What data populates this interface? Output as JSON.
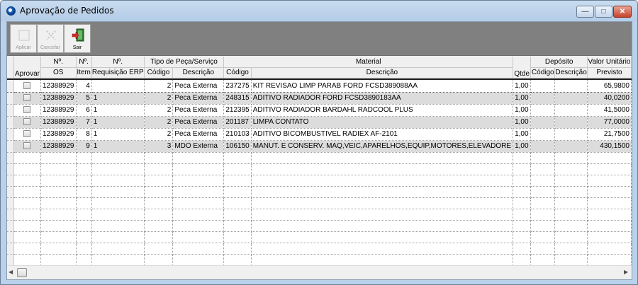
{
  "window": {
    "title": "Aprovação de Pedidos"
  },
  "toolbar": {
    "apply_label": "Aplicar",
    "cancel_label": "Cancelar",
    "exit_label": "Sair"
  },
  "grid": {
    "groups": {
      "tipo": "Tipo de Peça/Serviço",
      "material": "Material",
      "deposito": "Depósito"
    },
    "headers": {
      "aprovar": "Aprovar",
      "os_top": "Nº.",
      "os_bottom": "OS",
      "item_top": "Nº.",
      "item_bottom": "Item",
      "req_top": "Nº.",
      "req_bottom": "Requisição ERP",
      "tipo_codigo": "Código",
      "tipo_descricao": "Descrição",
      "mat_codigo": "Código",
      "mat_descricao": "Descrição",
      "qtde": "Qtde",
      "dep_codigo": "Código",
      "dep_descricao": "Descrição",
      "valor_top": "Valor Unitário",
      "valor_bottom": "Previsto"
    },
    "rows": [
      {
        "os": "12388929",
        "item": "4",
        "req": "",
        "tipo_cod": "2",
        "tipo_desc": "Peca Externa",
        "mat_cod": "237275",
        "mat_desc": "KIT REVISAO LIMP PARAB FORD FCSD389088AA",
        "qtde": "1,00",
        "dep_cod": "",
        "dep_desc": "",
        "valor": "65,9800"
      },
      {
        "os": "12388929",
        "item": "5",
        "req": "1",
        "tipo_cod": "2",
        "tipo_desc": "Peca Externa",
        "mat_cod": "248315",
        "mat_desc": "ADITIVO RADIADOR FORD FCSD3890183AA",
        "qtde": "1,00",
        "dep_cod": "",
        "dep_desc": "",
        "valor": "40,0200"
      },
      {
        "os": "12388929",
        "item": "6",
        "req": "1",
        "tipo_cod": "2",
        "tipo_desc": "Peca Externa",
        "mat_cod": "212395",
        "mat_desc": "ADITIVO RADIADOR BARDAHL RADCOOL PLUS",
        "qtde": "1,00",
        "dep_cod": "",
        "dep_desc": "",
        "valor": "41,5000"
      },
      {
        "os": "12388929",
        "item": "7",
        "req": "1",
        "tipo_cod": "2",
        "tipo_desc": "Peca Externa",
        "mat_cod": "201187",
        "mat_desc": "LIMPA CONTATO",
        "qtde": "1,00",
        "dep_cod": "",
        "dep_desc": "",
        "valor": "77,0000"
      },
      {
        "os": "12388929",
        "item": "8",
        "req": "1",
        "tipo_cod": "2",
        "tipo_desc": "Peca Externa",
        "mat_cod": "210103",
        "mat_desc": "ADITIVO BICOMBUSTIVEL RADIEX AF-2101",
        "qtde": "1,00",
        "dep_cod": "",
        "dep_desc": "",
        "valor": "21,7500"
      },
      {
        "os": "12388929",
        "item": "9",
        "req": "1",
        "tipo_cod": "3",
        "tipo_desc": "MDO Externa",
        "mat_cod": "106150",
        "mat_desc": "MANUT. E CONSERV. MAQ,VEIC,APARELHOS,EQUIP,MOTORES,ELEVADORE",
        "qtde": "1,00",
        "dep_cod": "",
        "dep_desc": "",
        "valor": "430,1500"
      }
    ]
  },
  "icons": {
    "app": "app-logo-icon",
    "apply": "apply-icon",
    "cancel": "cancel-icon",
    "exit": "exit-door-icon"
  },
  "colors": {
    "title_bar": "#b9d1ea",
    "toolbar": "#808080",
    "row_alt": "#dcdcdc",
    "close_button": "#c7432b"
  }
}
